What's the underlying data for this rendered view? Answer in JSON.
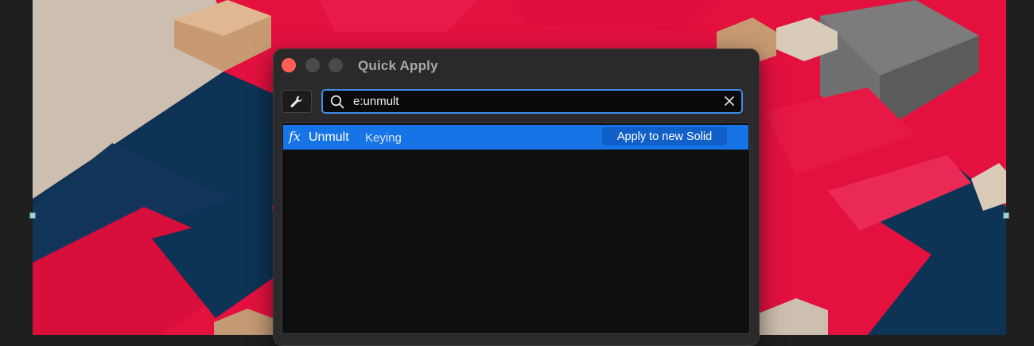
{
  "window": {
    "title": "Quick Apply"
  },
  "search": {
    "value": "e:unmult",
    "placeholder": ""
  },
  "results": [
    {
      "name": "Unmult",
      "category": "Keying",
      "action_label": "Apply to new Solid",
      "selected": true
    }
  ],
  "colors": {
    "accent": "#1774e6",
    "search_border": "#3f8de8",
    "close_button": "#ff5f57",
    "background_red": "#e4113f",
    "background_navy": "#0d3355"
  },
  "icons": {
    "tool_button": "wrench-icon",
    "search": "search-icon",
    "clear": "close-icon",
    "effect": "fx-icon"
  }
}
